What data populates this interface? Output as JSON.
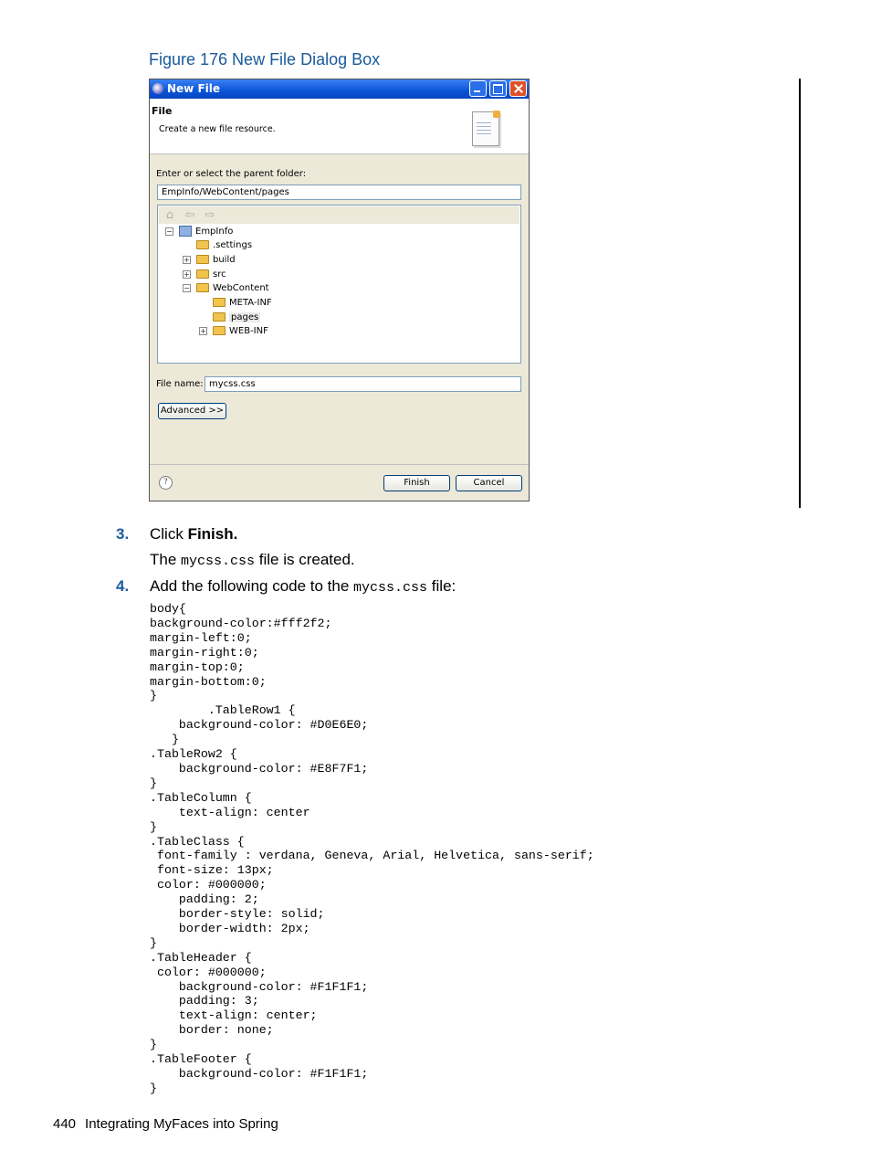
{
  "figure": {
    "caption": "Figure 176 New File Dialog Box"
  },
  "dialog": {
    "title": "New File",
    "header_title": "File",
    "header_desc": "Create a new file resource.",
    "parent_label": "Enter or select the parent folder:",
    "parent_value": "EmpInfo/WebContent/pages",
    "tree": {
      "toolbar_icons": [
        "home-icon",
        "back-arrow-icon",
        "forward-arrow-icon"
      ],
      "items": [
        {
          "label": "EmpInfo",
          "expander": "−"
        },
        {
          "label": ".settings",
          "expander": ""
        },
        {
          "label": "build",
          "expander": "+"
        },
        {
          "label": "src",
          "expander": "+"
        },
        {
          "label": "WebContent",
          "expander": "−"
        },
        {
          "label": "META-INF",
          "expander": ""
        },
        {
          "label": "pages",
          "expander": "",
          "selected": true
        },
        {
          "label": "WEB-INF",
          "expander": "+"
        }
      ]
    },
    "filename_label": "File name:",
    "filename_value": "mycss.css",
    "advanced_label": "Advanced >>",
    "help_symbol": "?",
    "finish_label": "Finish",
    "cancel_label": "Cancel"
  },
  "steps": [
    {
      "num": "3.",
      "pre": "Click ",
      "bold": "Finish."
    },
    {
      "num": "4.",
      "pre": "Add the following code to the ",
      "code": "mycss.css",
      "post": " file:"
    }
  ],
  "step3_result": {
    "pre": "The ",
    "code": "mycss.css",
    "post": " file is created."
  },
  "code_block": "body{\nbackground-color:#fff2f2;\nmargin-left:0;\nmargin-right:0;\nmargin-top:0;\nmargin-bottom:0;\n}\n        .TableRow1 {\n    background-color: #D0E6E0;\n   }\n.TableRow2 {\n    background-color: #E8F7F1;\n}\n.TableColumn {\n    text-align: center\n}\n.TableClass {\n font-family : verdana, Geneva, Arial, Helvetica, sans-serif;\n font-size: 13px;\n color: #000000;\n    padding: 2;\n    border-style: solid;\n    border-width: 2px;\n}\n.TableHeader {\n color: #000000;\n    background-color: #F1F1F1;\n    padding: 3;\n    text-align: center;\n    border: none;\n}\n.TableFooter {\n    background-color: #F1F1F1;\n}",
  "footer": {
    "page_number": "440",
    "section": "Integrating MyFaces into Spring"
  },
  "colors": {
    "caption_blue": "#1a5a9c",
    "titlebar_blue": "#0a54d8"
  }
}
